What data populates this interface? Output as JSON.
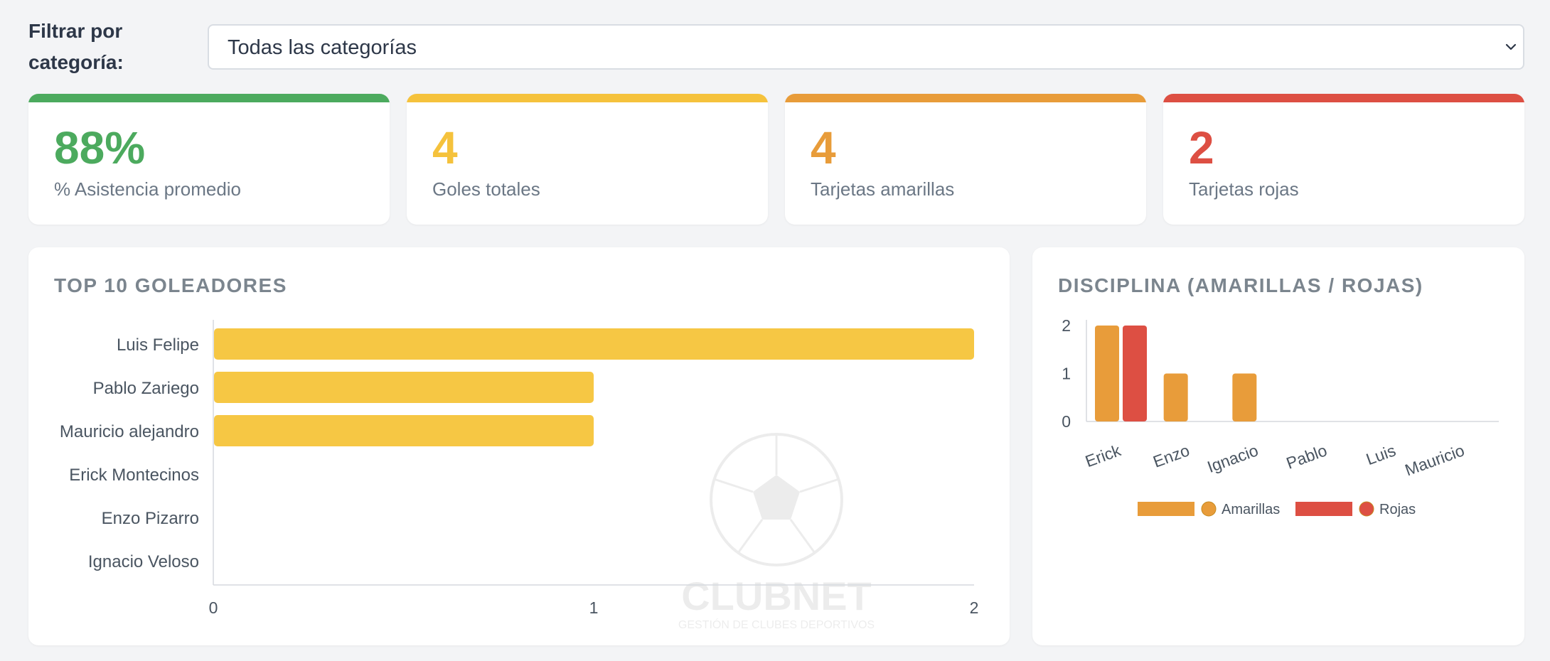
{
  "filter": {
    "label": "Filtrar por categoría:",
    "selected": "Todas las categorías"
  },
  "kpis": [
    {
      "value": "88%",
      "label": "% Asistencia promedio",
      "color": "#4caa5e"
    },
    {
      "value": "4",
      "label": "Goles totales",
      "color": "#f5c23c"
    },
    {
      "value": "4",
      "label": "Tarjetas amarillas",
      "color": "#e89c3a"
    },
    {
      "value": "2",
      "label": "Tarjetas rojas",
      "color": "#dd4f43"
    }
  ],
  "scorers": {
    "title": "TOP 10 GOLEADORES",
    "watermark": {
      "name": "CLUBNET",
      "tagline": "GESTIÓN DE CLUBES DEPORTIVOS"
    },
    "chart_data": {
      "type": "bar",
      "orientation": "horizontal",
      "categories": [
        "Luis Felipe",
        "Pablo Zariego",
        "Mauricio alejandro",
        "Erick Montecinos",
        "Enzo Pizarro",
        "Ignacio Veloso"
      ],
      "values": [
        2,
        1,
        1,
        0,
        0,
        0
      ],
      "xlim": [
        0,
        2
      ],
      "xticks": [
        "0",
        "1",
        "2"
      ],
      "color": "#f6c744",
      "grid": false
    }
  },
  "discipline": {
    "title": "DISCIPLINA (AMARILLAS / ROJAS)",
    "chart_data": {
      "type": "bar",
      "categories": [
        "Erick",
        "Enzo",
        "Ignacio",
        "Pablo",
        "Luis",
        "Mauricio"
      ],
      "series": [
        {
          "name": "Amarillas",
          "values": [
            2,
            1,
            1,
            0,
            0,
            0
          ],
          "color": "#e89c3a"
        },
        {
          "name": "Rojas",
          "values": [
            2,
            0,
            0,
            0,
            0,
            0
          ],
          "color": "#dd4f43"
        }
      ],
      "ylim": [
        0,
        2
      ],
      "yticks": [
        "0",
        "1",
        "2"
      ],
      "legend": "bottom",
      "grid": false
    }
  }
}
